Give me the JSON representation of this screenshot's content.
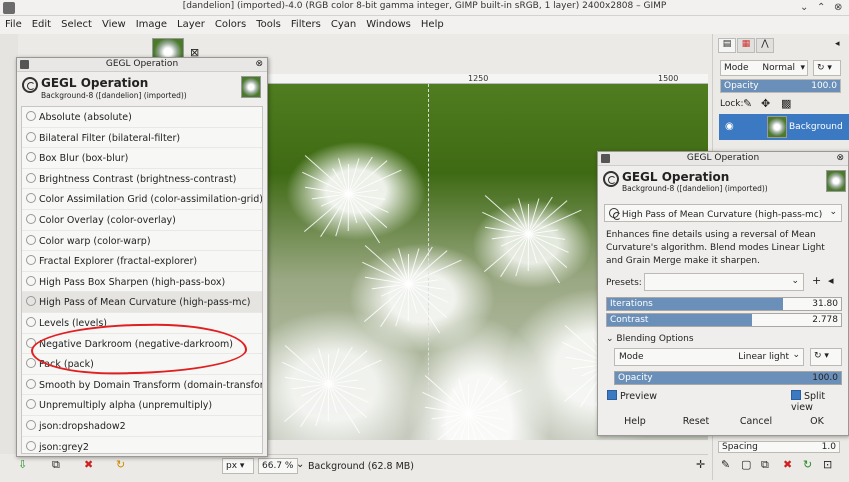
{
  "window": {
    "title": "[dandelion] (imported)-4.0 (RGB color 8-bit gamma integer, GIMP built-in sRGB, 1 layer) 2400x2808 – GIMP"
  },
  "menubar": [
    "File",
    "Edit",
    "Select",
    "View",
    "Image",
    "Layer",
    "Colors",
    "Tools",
    "Filters",
    "Cyan",
    "Windows",
    "Help"
  ],
  "ruler": {
    "mark_1250": "1250",
    "mark_1500": "1500"
  },
  "status": {
    "unit": "px",
    "zoom": "66.7 %",
    "layer_info": "Background (62.8 MB)"
  },
  "dock": {
    "mode_label": "Mode",
    "mode_value": "Normal",
    "opacity_label": "Opacity",
    "opacity_value": "100.0",
    "lock_label": "Lock:",
    "layer_name": "Background",
    "spacing_label": "Spacing",
    "spacing_value": "1.0"
  },
  "list_dialog": {
    "window_title": "GEGL Operation",
    "heading": "GEGL Operation",
    "subtitle": "Background-8 ([dandelion] (imported))",
    "operations": [
      "Absolute (absolute)",
      "Bilateral Filter (bilateral-filter)",
      "Box Blur (box-blur)",
      "Brightness Contrast (brightness-contrast)",
      "Color Assimilation Grid (color-assimilation-grid)",
      "Color Overlay (color-overlay)",
      "Color warp (color-warp)",
      "Fractal Explorer (fractal-explorer)",
      "High Pass Box Sharpen (high-pass-box)",
      "High Pass of Mean Curvature (high-pass-mc)",
      "Levels (levels)",
      "Negative Darkroom (negative-darkroom)",
      "Pack (pack)",
      "Smooth by Domain Transform (domain-transform)",
      "Unpremultiply alpha (unpremultiply)",
      "json:dropshadow2",
      "json:grey2"
    ]
  },
  "op_dialog": {
    "window_title": "GEGL Operation",
    "heading": "GEGL Operation",
    "subtitle": "Background-8 ([dandelion] (imported))",
    "selected_op": "High Pass of Mean Curvature (high-pass-mc)",
    "description": "Enhances fine details using a reversal of Mean Curvature's algorithm. Blend modes Linear Light and Grain Merge make it sharpen.",
    "presets_label": "Presets:",
    "iterations_label": "Iterations",
    "iterations_value": "31.80",
    "iterations_fraction": 0.75,
    "contrast_label": "Contrast",
    "contrast_value": "2.778",
    "contrast_fraction": 0.62,
    "blending_label": "Blending Options",
    "blend_mode_label": "Mode",
    "blend_mode_value": "Linear light",
    "opacity_label": "Opacity",
    "opacity_value": "100.0",
    "preview_label": "Preview",
    "split_view_label": "Split view",
    "help_label": "Help",
    "reset_label": "Reset",
    "cancel_label": "Cancel",
    "ok_label": "OK"
  },
  "colors": {
    "accent": "#3b79c2",
    "slider_fill": "#6a8fb8",
    "annotation": "#e02020"
  }
}
